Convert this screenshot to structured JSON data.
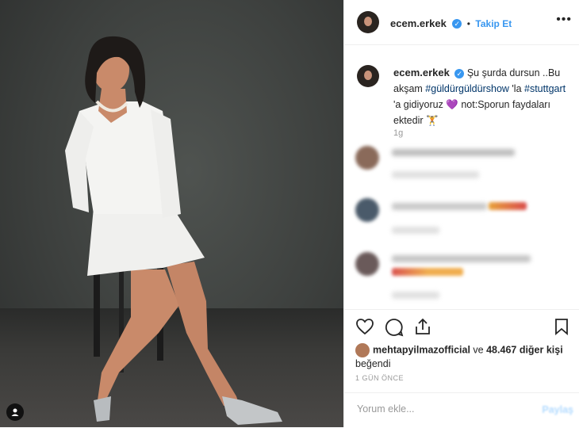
{
  "post": {
    "username": "ecem.erkek",
    "follow_label": "Takip Et",
    "more_glyph": "•••",
    "caption_username": "ecem.erkek",
    "caption_text_1": "Şu şurda dursun ..Bu akşam ",
    "hashtag_1": "#güldürgüldürshow",
    "caption_text_2": " 'la ",
    "hashtag_2": "#stuttgart",
    "caption_text_3": " 'a gidiyoruz 💜 not:Sporun faydaları ektedir 🏋",
    "caption_time": "1g",
    "likes_user": "mehtapyilmazofficial",
    "likes_text_mid": " ve ",
    "likes_count": "48.467 diğer kişi",
    "likes_text_end": "beğendi",
    "post_time": "1 GÜN ÖNCE",
    "comment_placeholder": "Yorum ekle...",
    "post_button": "Paylaş"
  },
  "icons": {
    "verified": "✓",
    "like": "heart-icon",
    "comment": "comment-icon",
    "share": "share-icon",
    "save": "bookmark-icon",
    "user_tag": "person-icon"
  },
  "colors": {
    "accent": "#3897f0",
    "text": "#262626",
    "muted": "#999999",
    "hashtag": "#003569"
  }
}
